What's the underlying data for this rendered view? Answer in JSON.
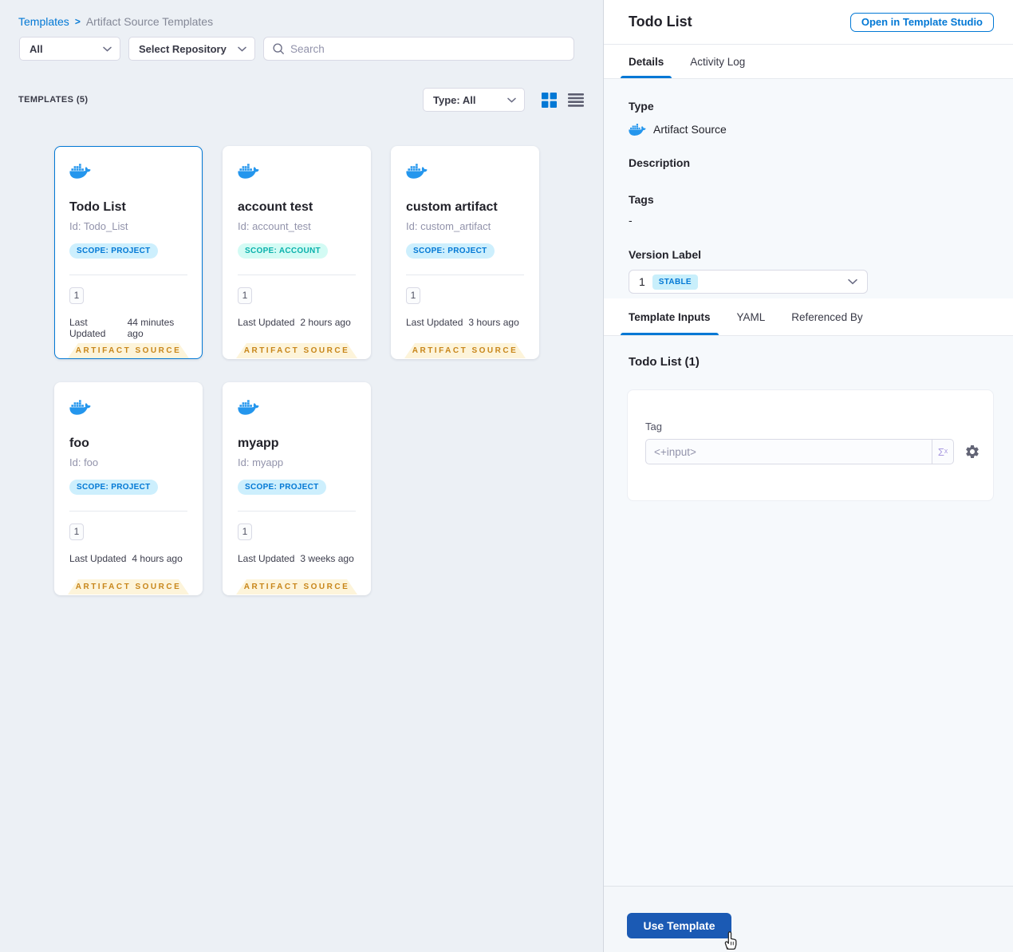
{
  "breadcrumb": {
    "root": "Templates",
    "separator": ">",
    "current": "Artifact Source Templates"
  },
  "filters": {
    "scope_filter": "All",
    "repository_filter": "Select Repository",
    "search_placeholder": "Search"
  },
  "toolbar": {
    "count_label": "TEMPLATES (5)",
    "type_filter": "Type: All"
  },
  "labels": {
    "last_updated": "Last Updated",
    "artifact_source_ribbon": "ARTIFACT SOURCE"
  },
  "cards": [
    {
      "title": "Todo List",
      "id": "Id: Todo_List",
      "scope": "SCOPE: PROJECT",
      "scope_type": "project",
      "version": "1",
      "updated": "44 minutes ago"
    },
    {
      "title": "account test",
      "id": "Id: account_test",
      "scope": "SCOPE: ACCOUNT",
      "scope_type": "account",
      "version": "1",
      "updated": "2 hours ago"
    },
    {
      "title": "custom artifact",
      "id": "Id: custom_artifact",
      "scope": "SCOPE: PROJECT",
      "scope_type": "project",
      "version": "1",
      "updated": "3 hours ago"
    },
    {
      "title": "foo",
      "id": "Id: foo",
      "scope": "SCOPE: PROJECT",
      "scope_type": "project",
      "version": "1",
      "updated": "4 hours ago"
    },
    {
      "title": "myapp",
      "id": "Id: myapp",
      "scope": "SCOPE: PROJECT",
      "scope_type": "project",
      "version": "1",
      "updated": "3 weeks ago"
    }
  ],
  "panel": {
    "title": "Todo List",
    "open_button": "Open in Template Studio",
    "tabs": {
      "details": "Details",
      "activity_log": "Activity Log"
    },
    "details": {
      "type_label": "Type",
      "type_value": "Artifact Source",
      "description_label": "Description",
      "tags_label": "Tags",
      "tags_value": "-",
      "version_label": "Version Label",
      "version_value": "1",
      "version_badge": "STABLE"
    },
    "sub_tabs": {
      "template_inputs": "Template Inputs",
      "yaml": "YAML",
      "referenced_by": "Referenced By"
    },
    "inputs": {
      "heading": "Todo List (1)",
      "tag_label": "Tag",
      "tag_value": "<+input>",
      "expression_icon": "Σˣ"
    },
    "footer": {
      "use_template": "Use Template"
    }
  },
  "colors": {
    "accent_blue": "#0278d5",
    "docker_blue": "#2496ed",
    "use_template_button": "#1b5ab4",
    "scope_project_bg": "#cdeffd",
    "scope_account_text": "#0ab1ac",
    "scope_account_bg": "#d3fbf4",
    "ribbon_bg": "#fdf4da",
    "ribbon_text": "#c8861a",
    "stable_badge_bg": "#c9effb",
    "left_background": "#ecf0f5",
    "section_background": "#f6f9fc"
  }
}
